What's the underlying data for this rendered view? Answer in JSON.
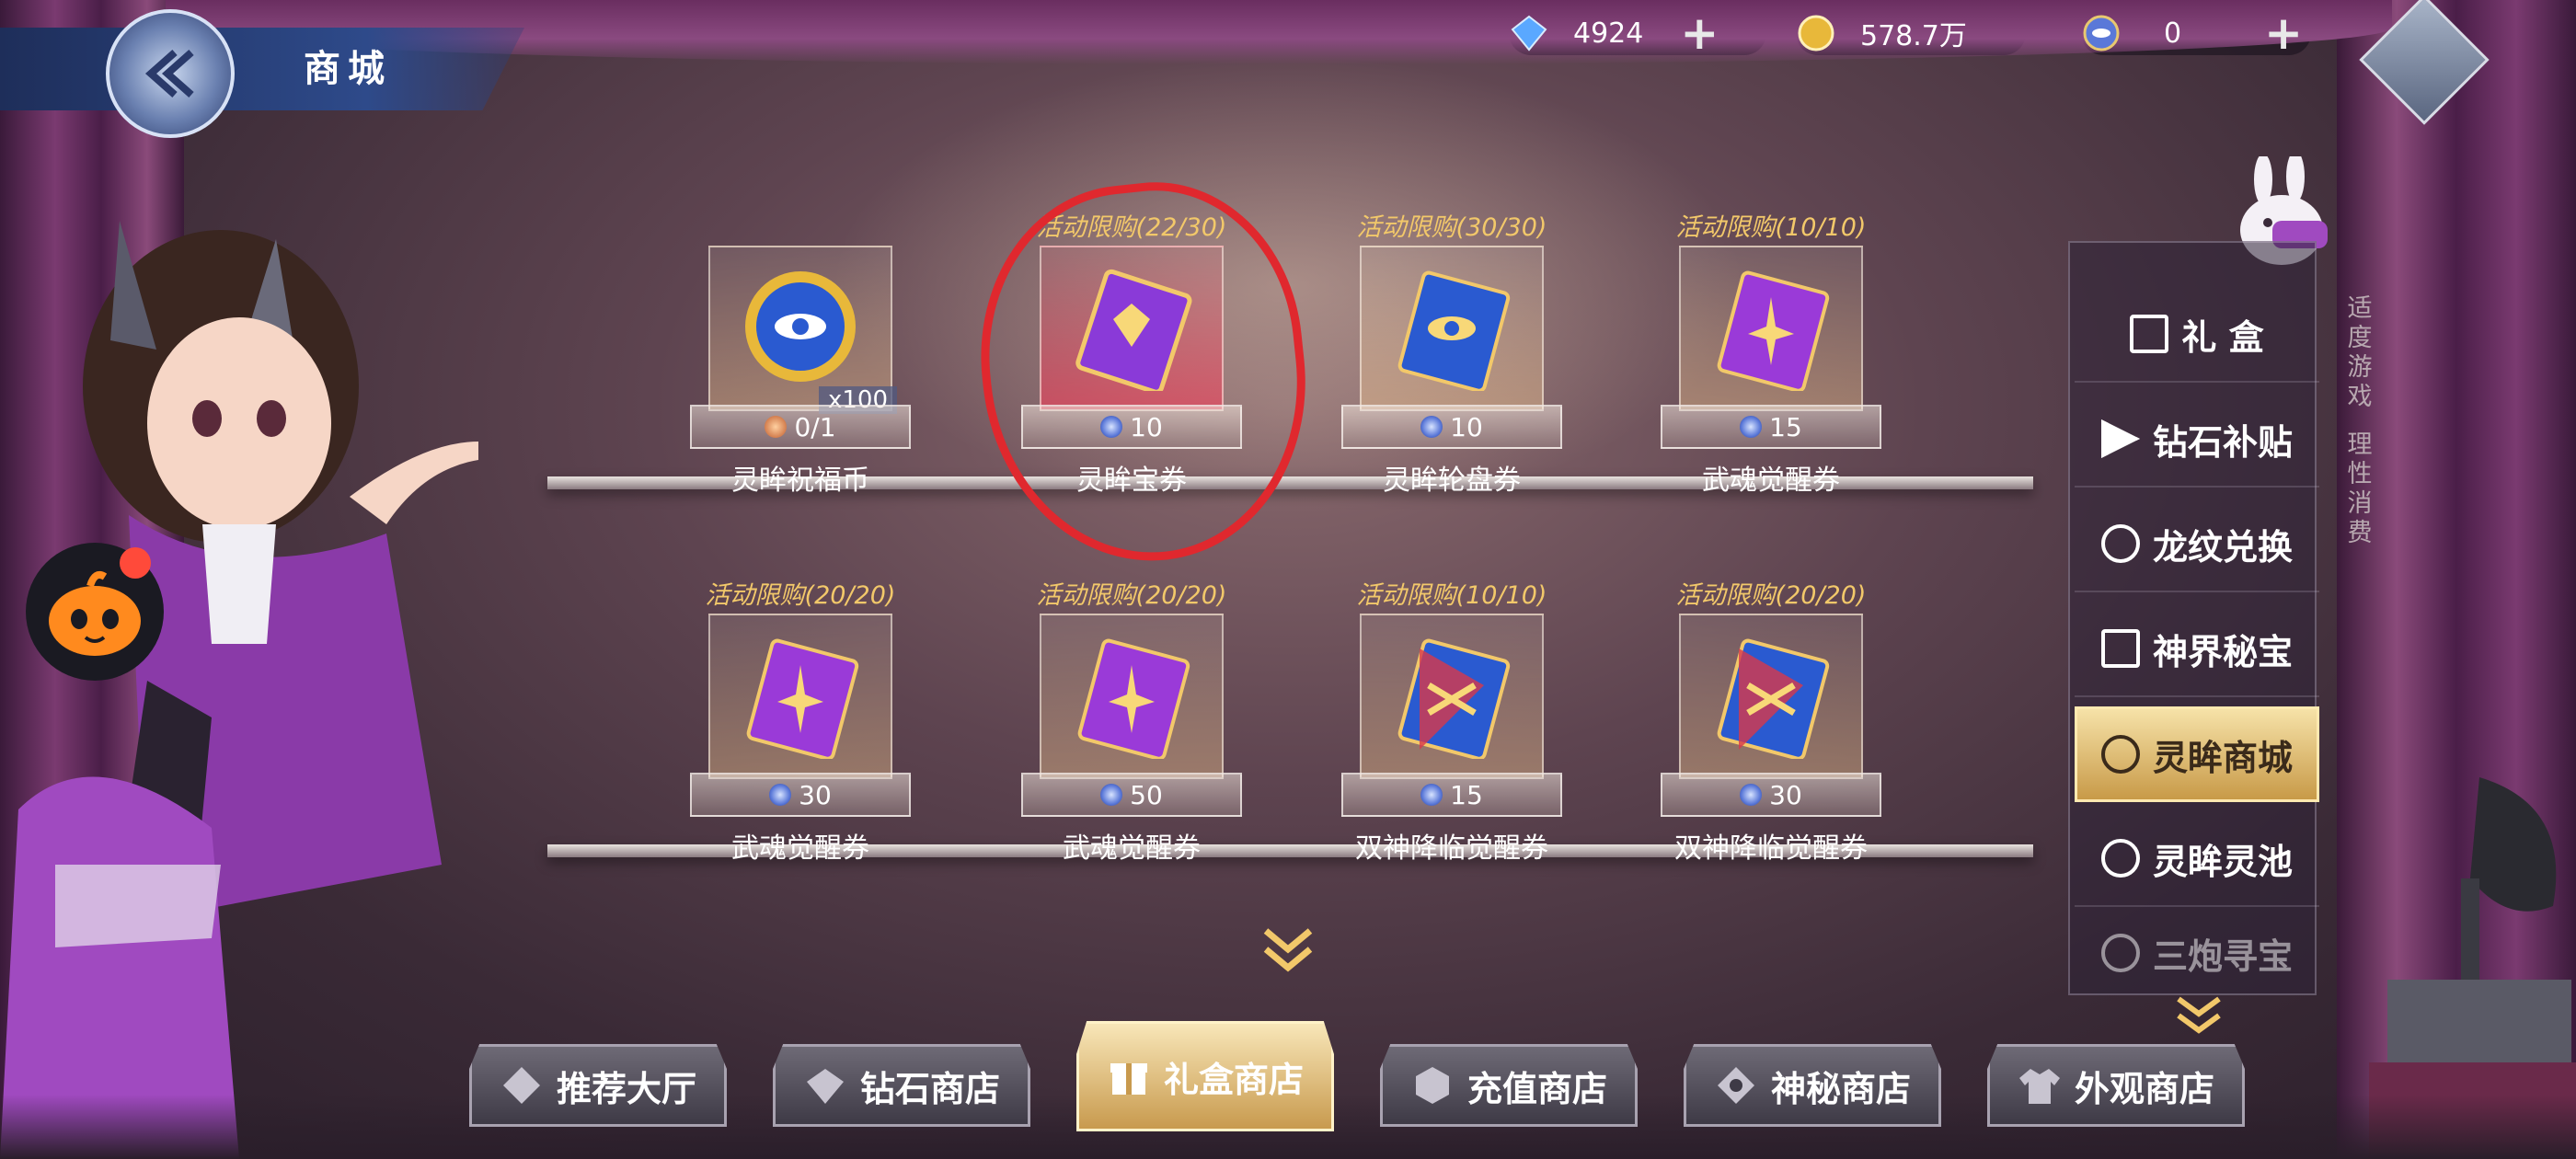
{
  "header": {
    "title": "商城",
    "currencies": [
      {
        "icon": "diamond-icon",
        "value": "4924"
      },
      {
        "icon": "gold-coin-icon",
        "value": "578.7万"
      },
      {
        "icon": "spirit-eye-coupon-icon",
        "value": "0"
      }
    ]
  },
  "shelf_top": [
    {
      "limit": "",
      "name": "灵眸祝福币",
      "price": "0/1",
      "qty": "x100",
      "icon": "spirit-blessing-coin-icon"
    },
    {
      "limit": "活动限购(22/30)",
      "name": "灵眸宝券",
      "price": "10",
      "icon": "spirit-treasure-ticket-icon"
    },
    {
      "limit": "活动限购(30/30)",
      "name": "灵眸轮盘券",
      "price": "10",
      "icon": "spirit-wheel-ticket-icon"
    },
    {
      "limit": "活动限购(10/10)",
      "name": "武魂觉醒券",
      "price": "15",
      "icon": "soul-awaken-ticket-icon"
    }
  ],
  "shelf_bottom": [
    {
      "limit": "活动限购(20/20)",
      "name": "武魂觉醒券",
      "price": "30",
      "icon": "soul-awaken-ticket-icon"
    },
    {
      "limit": "活动限购(20/20)",
      "name": "武魂觉醒券",
      "price": "50",
      "icon": "soul-awaken-ticket-icon"
    },
    {
      "limit": "活动限购(10/10)",
      "name": "双神降临觉醒券",
      "price": "15",
      "icon": "twin-god-ticket-icon"
    },
    {
      "limit": "活动限购(20/20)",
      "name": "双神降临觉醒券",
      "price": "30",
      "icon": "twin-god-ticket-icon"
    }
  ],
  "side_nav": {
    "items": [
      "礼 盒",
      "钻石补贴",
      "龙纹兑换",
      "神界秘宝",
      "灵眸商城",
      "灵眸灵池",
      "三炮寻宝"
    ],
    "active": "灵眸商城"
  },
  "side_note": [
    "适度游戏",
    "理性消费"
  ],
  "bottom_tabs": {
    "items": [
      "推荐大厅",
      "钻石商店",
      "礼盒商店",
      "充值商店",
      "神秘商店",
      "外观商店"
    ],
    "active": "礼盒商店"
  },
  "colors": {
    "accent_gold": "#f2c86a",
    "annotation_red": "#e0282e",
    "header_blue": "#2e4a8a"
  }
}
